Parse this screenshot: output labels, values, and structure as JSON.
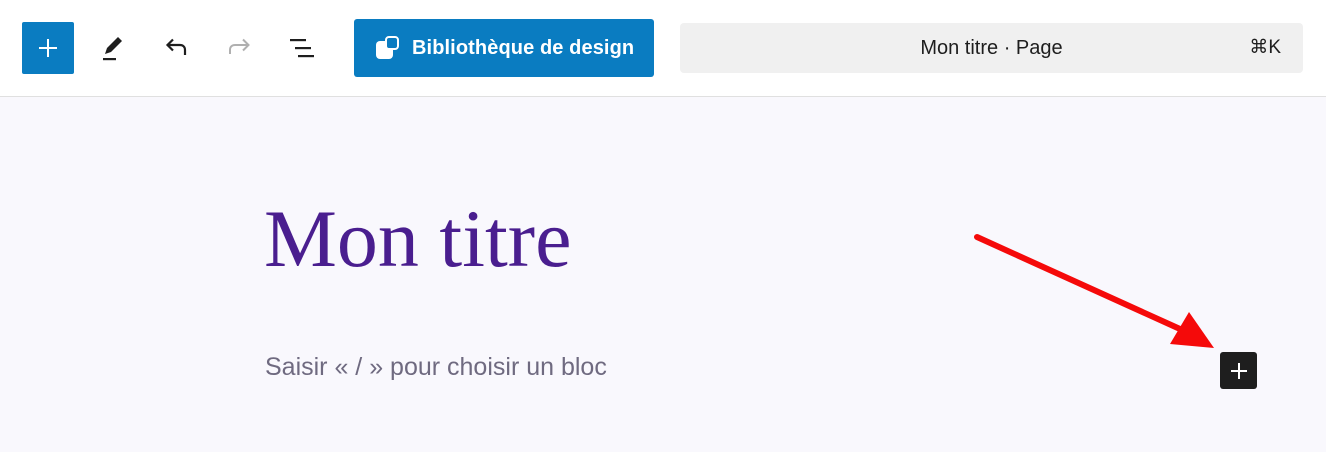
{
  "toolbar": {
    "icons": {
      "add": "plus-icon",
      "edit": "pencil-icon",
      "undo": "undo-icon",
      "redo": "redo-icon",
      "outline": "list-view-icon"
    },
    "design_library_label": "Bibliothèque de design",
    "command_bar": {
      "label": "Mon titre · Page",
      "shortcut": "⌘K"
    }
  },
  "editor": {
    "title": "Mon titre",
    "placeholder": "Saisir « / » pour choisir un bloc",
    "inline_add_icon": "plus-icon"
  },
  "annotation": {
    "color": "#f50a0a"
  },
  "colors": {
    "accent": "#0a7cc1",
    "title": "#4a1e8f",
    "canvas": "#f9f8fd"
  }
}
